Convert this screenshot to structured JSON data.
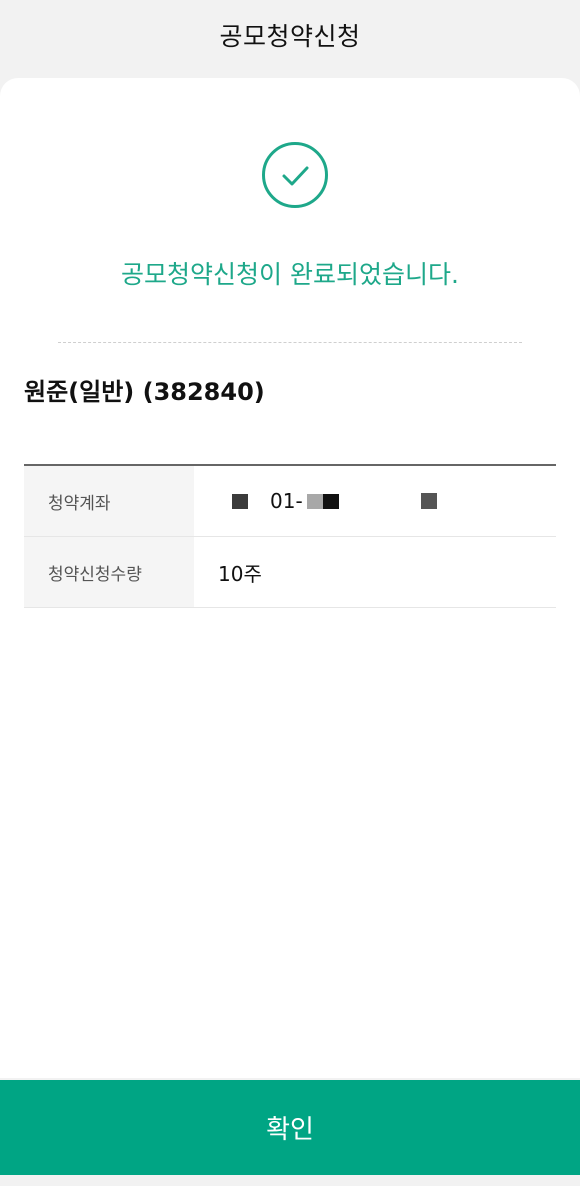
{
  "header": {
    "title": "공모청약신청"
  },
  "result": {
    "message": "공모청약신청이 완료되었습니다.",
    "stock_name": "원준(일반) (382840)"
  },
  "details": [
    {
      "label": "청약계좌",
      "value": "01-"
    },
    {
      "label": "청약신청수량",
      "value": "10주"
    }
  ],
  "confirm": {
    "label": "확인"
  },
  "colors": {
    "accent": "#1ea88a",
    "button": "#00a584"
  }
}
